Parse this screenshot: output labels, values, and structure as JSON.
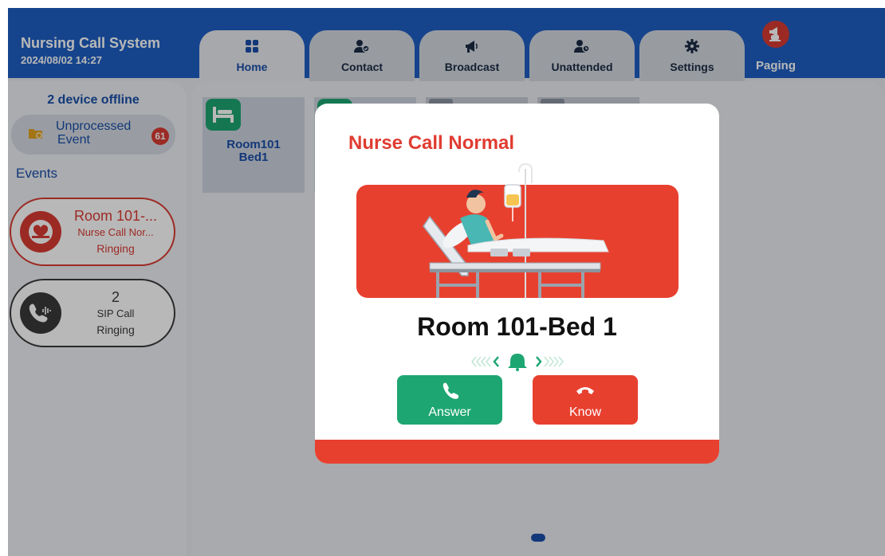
{
  "header": {
    "title": "Nursing Call System",
    "datetime": "2024/08/02 14:27",
    "tabs": [
      {
        "label": "Home",
        "icon": "grid-icon"
      },
      {
        "label": "Contact",
        "icon": "contact-icon"
      },
      {
        "label": "Broadcast",
        "icon": "megaphone-icon"
      },
      {
        "label": "Unattended",
        "icon": "user-clock-icon"
      },
      {
        "label": "Settings",
        "icon": "gear-icon"
      }
    ],
    "paging_label": "Paging"
  },
  "sidebar": {
    "offline_text": "2 device offline",
    "unprocessed": {
      "line1": "Unprocessed",
      "line2": "Event",
      "count": "61"
    },
    "events_label": "Events",
    "events": [
      {
        "line1": "Room 101-...",
        "line2": "Nurse Call Nor...",
        "line3": "Ringing",
        "icon": "bed-heart-icon"
      },
      {
        "line1": "2",
        "line2": "SIP Call",
        "line3": "Ringing",
        "icon": "phone-wave-icon"
      }
    ]
  },
  "main": {
    "beds": [
      {
        "line1": "Room101",
        "line2": "Bed1"
      }
    ]
  },
  "modal": {
    "title": "Nurse Call Normal",
    "room": "Room 101-Bed 1",
    "answer_label": "Answer",
    "know_label": "Know"
  },
  "colors": {
    "header_blue": "#1f5fc2",
    "accent_red": "#e8402f",
    "accent_green": "#1ea672",
    "text_blue": "#1a4ea8"
  }
}
